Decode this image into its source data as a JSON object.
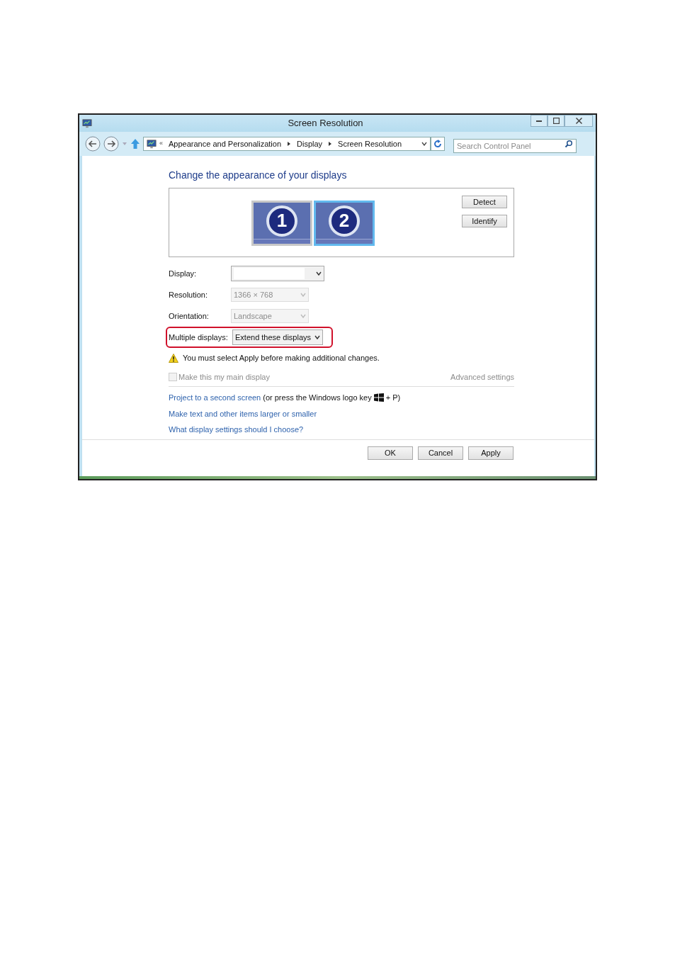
{
  "window": {
    "title": "Screen Resolution"
  },
  "address_bar": {
    "overflow": "«",
    "breadcrumb": [
      "Appearance and Personalization",
      "Display",
      "Screen Resolution"
    ]
  },
  "search": {
    "placeholder": "Search Control Panel"
  },
  "heading": "Change the appearance of your displays",
  "monitors": [
    {
      "label": "1",
      "selected": false
    },
    {
      "label": "2",
      "selected": true
    }
  ],
  "display_buttons": [
    "Detect",
    "Identify"
  ],
  "settings": [
    {
      "label": "Display:",
      "kind": "dropdown",
      "disabled": false,
      "highlighted": false
    },
    {
      "label": "Resolution:",
      "value": "1366 × 768",
      "kind": "dropdown",
      "disabled": true,
      "highlighted": false
    },
    {
      "label": "Orientation:",
      "value": "Landscape",
      "kind": "dropdown",
      "disabled": true,
      "highlighted": false
    },
    {
      "label": "Multiple displays:",
      "value": "Extend these displays",
      "kind": "dropdown",
      "disabled": false,
      "highlighted": true
    }
  ],
  "warning": "You must select Apply before making additional changes.",
  "main_display": {
    "label": "Make this my main display",
    "checked": false,
    "disabled": true
  },
  "advanced_link": "Advanced settings",
  "links": [
    {
      "text": "Project to a second screen",
      "note_before": "(or press the Windows logo key",
      "note_after": "+ P)"
    },
    {
      "text": "Make text and other items larger or smaller"
    },
    {
      "text": "What display settings should I choose?"
    }
  ],
  "footer_buttons": [
    "OK",
    "Cancel",
    "Apply"
  ]
}
